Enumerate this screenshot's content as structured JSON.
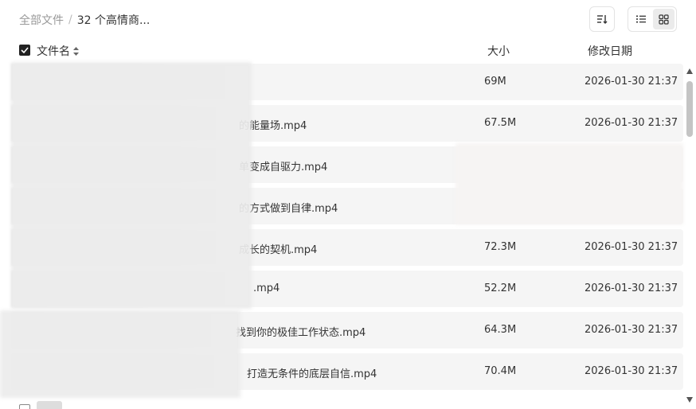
{
  "breadcrumb": {
    "root": "全部文件",
    "separator": "/",
    "current": "32 个高情商..."
  },
  "toolbar": {
    "sort_icon": "sort-icon",
    "list_view_icon": "list-view-icon",
    "grid_view_icon": "grid-view-icon",
    "active_view": "list"
  },
  "header": {
    "name": "文件名",
    "size": "大小",
    "date": "修改日期",
    "select_all_checked": true
  },
  "rows": [
    {
      "name": "",
      "size": "69M",
      "date": "2026-01-30 21:37"
    },
    {
      "name": "的能量场.mp4",
      "size": "67.5M",
      "date": "2026-01-30 21:37"
    },
    {
      "name": "单变成自驱力.mp4",
      "size": "",
      "date": ""
    },
    {
      "name": "的方式做到自律.mp4",
      "size": "",
      "date": ""
    },
    {
      "name": "成长的契机.mp4",
      "size": "72.3M",
      "date": "2026-01-30 21:37"
    },
    {
      "name": ".mp4",
      "size": "52.2M",
      "date": "2026-01-30 21:37"
    },
    {
      "name": "找到你的极佳工作状态.mp4",
      "size": "64.3M",
      "date": "2026-01-30 21:37"
    },
    {
      "name": "打造无条件的底层自信.mp4",
      "size": "70.4M",
      "date": "2026-01-30 21:37"
    }
  ],
  "colors": {
    "row_bg": "#f5f5f5",
    "text": "#333333",
    "muted": "#999999"
  }
}
